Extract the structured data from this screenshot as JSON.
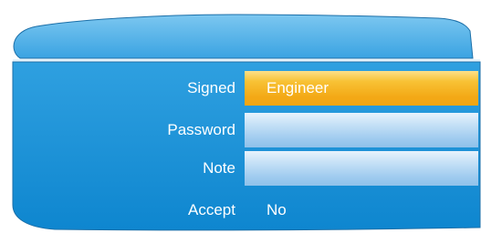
{
  "form": {
    "rows": [
      {
        "label": "Signed",
        "value": "Engineer",
        "state": "selected"
      },
      {
        "label": "Password",
        "value": "",
        "state": "input"
      },
      {
        "label": "Note",
        "value": "",
        "state": "input"
      },
      {
        "label": "Accept",
        "value": "No",
        "state": "plain"
      }
    ]
  },
  "colors": {
    "panel_top": "#5eb7ea",
    "panel_bottom": "#148bd2",
    "selected_field": "#f4ab19",
    "input_field": "#a6cff0"
  }
}
